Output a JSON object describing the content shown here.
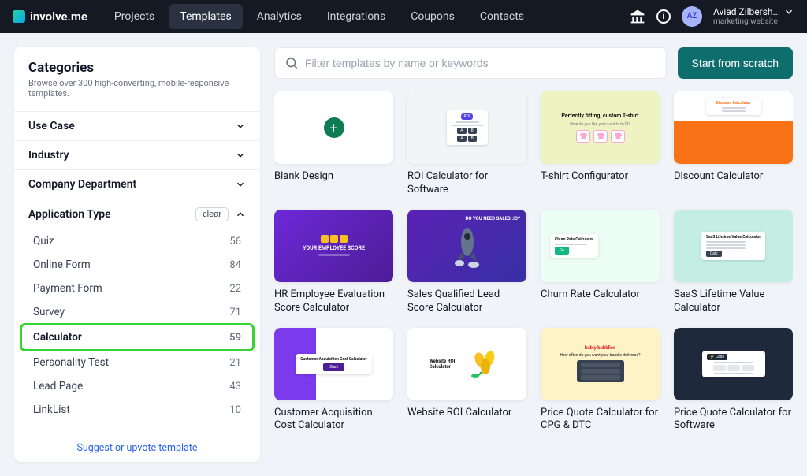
{
  "brand": "involve.me",
  "nav": {
    "items": [
      "Projects",
      "Templates",
      "Analytics",
      "Integrations",
      "Coupons",
      "Contacts"
    ],
    "active_index": 1
  },
  "user": {
    "initials": "AZ",
    "name": "Aviad Zilbersh...",
    "sub": "marketing website"
  },
  "sidebar": {
    "title": "Categories",
    "subtitle": "Browse over 300 high-converting, mobile-responsive templates.",
    "sections": [
      {
        "label": "Use Case",
        "expanded": false
      },
      {
        "label": "Industry",
        "expanded": false
      },
      {
        "label": "Company Department",
        "expanded": false
      },
      {
        "label": "Application Type",
        "expanded": true,
        "clear": "clear"
      }
    ],
    "app_types": [
      {
        "label": "Quiz",
        "count": 56
      },
      {
        "label": "Online Form",
        "count": 84
      },
      {
        "label": "Payment Form",
        "count": 22
      },
      {
        "label": "Survey",
        "count": 71
      },
      {
        "label": "Calculator",
        "count": 59,
        "selected": true
      },
      {
        "label": "Personality Test",
        "count": 21
      },
      {
        "label": "Lead Page",
        "count": 43
      },
      {
        "label": "LinkList",
        "count": 10
      }
    ],
    "suggest": "Suggest or upvote template"
  },
  "toolbar": {
    "placeholder": "Filter templates by name or keywords",
    "scratch": "Start from scratch"
  },
  "templates": [
    {
      "title": "Blank Design"
    },
    {
      "title": "ROI Calculator for Software"
    },
    {
      "title": "T-shirt Configurator"
    },
    {
      "title": "Discount Calculator"
    },
    {
      "title": "HR Employee Evaluation Score Calculator"
    },
    {
      "title": "Sales Qualified Lead Score Calculator"
    },
    {
      "title": "Churn Rate Calculator"
    },
    {
      "title": "SaaS Lifetime Value Calculator"
    },
    {
      "title": "Customer Acquisition Cost Calculator"
    },
    {
      "title": "Website ROI Calculator"
    },
    {
      "title": "Price Quote Calculator for CPG & DTC"
    },
    {
      "title": "Price Quote Calculator for Software"
    }
  ],
  "thumb_text": {
    "tshirt_head": "Perfectly fitting, custom T-shirt",
    "tshirt_sub": "How do you like your t-shirts to fit?",
    "discount": "Discount Calculator",
    "emp_score": "YOUR EMPLOYEE SCORE",
    "sales_q": "DO YOU NEED SALES..IO?",
    "churn": "Churn Rate Calculator",
    "saas": "SaaS Lifetime Value Calculator",
    "cac_head": "Customer Acquisition Cost Calculator",
    "web_roi": "Website ROI Calculator",
    "bubly": "bubly bubblies",
    "bubly_q": "How often do you want your bundle delivered?"
  }
}
